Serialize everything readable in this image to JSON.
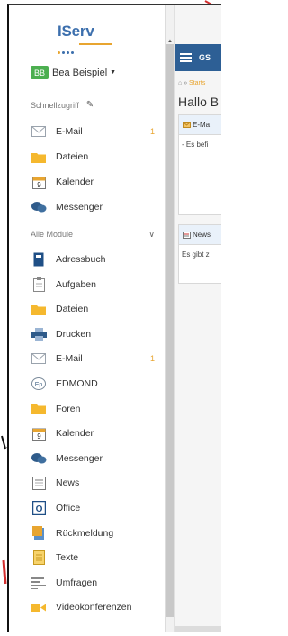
{
  "app": {
    "name": "IServ"
  },
  "user": {
    "initials": "BB",
    "name": "Bea Beispiel"
  },
  "quick_access": {
    "heading": "Schnellzugriff",
    "items": [
      {
        "label": "E-Mail",
        "icon": "envelope-icon",
        "badge": "1"
      },
      {
        "label": "Dateien",
        "icon": "folder-icon"
      },
      {
        "label": "Kalender",
        "icon": "calendar-icon"
      },
      {
        "label": "Messenger",
        "icon": "chat-bubbles-icon"
      }
    ]
  },
  "all_modules": {
    "heading": "Alle Module",
    "items": [
      {
        "label": "Adressbuch",
        "icon": "address-book-icon"
      },
      {
        "label": "Aufgaben",
        "icon": "clipboard-icon"
      },
      {
        "label": "Dateien",
        "icon": "folder-icon"
      },
      {
        "label": "Drucken",
        "icon": "printer-icon"
      },
      {
        "label": "E-Mail",
        "icon": "envelope-icon",
        "badge": "1"
      },
      {
        "label": "EDMOND",
        "icon": "edmond-icon"
      },
      {
        "label": "Foren",
        "icon": "forum-icon"
      },
      {
        "label": "Kalender",
        "icon": "calendar-icon"
      },
      {
        "label": "Messenger",
        "icon": "chat-bubbles-icon"
      },
      {
        "label": "News",
        "icon": "newspaper-icon"
      },
      {
        "label": "Office",
        "icon": "office-icon"
      },
      {
        "label": "Rückmeldung",
        "icon": "feedback-icon"
      },
      {
        "label": "Texte",
        "icon": "text-document-icon"
      },
      {
        "label": "Umfragen",
        "icon": "poll-icon"
      },
      {
        "label": "Videokonferenzen",
        "icon": "video-camera-icon"
      }
    ]
  },
  "topbar": {
    "title": "GS"
  },
  "breadcrumb": {
    "separator": "»",
    "current": "Starts"
  },
  "main": {
    "greeting": "Hallo B",
    "email_panel": {
      "title": "E-Ma",
      "body": "- Es befi"
    },
    "news_panel": {
      "title": "News",
      "body": "Es gibt z"
    }
  },
  "colors": {
    "brand_blue": "#2d5f95",
    "logo_blue": "#3c6fad",
    "accent_orange": "#e8a530",
    "avatar_green": "#4caf50"
  }
}
